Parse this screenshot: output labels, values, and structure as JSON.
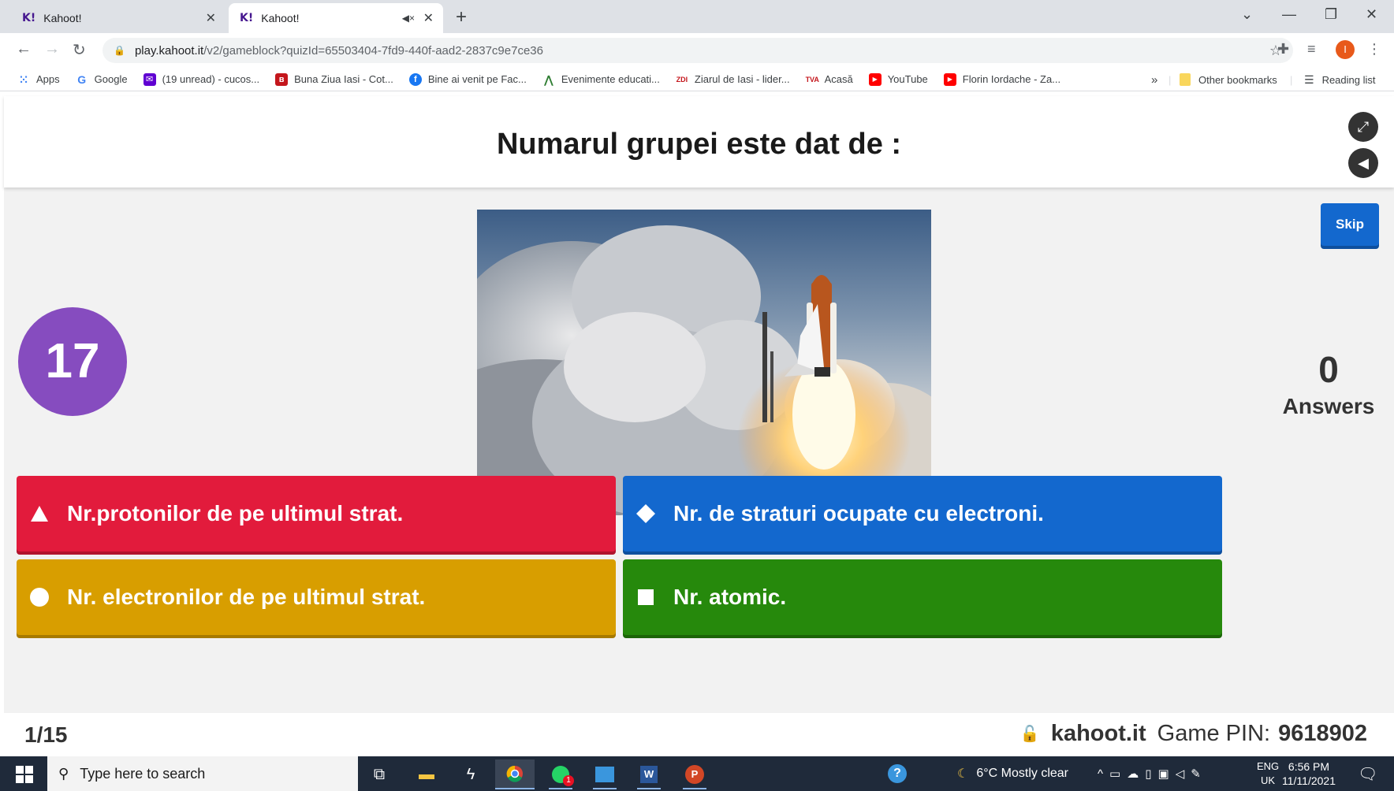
{
  "browser": {
    "tabs": [
      {
        "favicon": "K!",
        "title": "Kahoot!"
      },
      {
        "favicon": "K!",
        "title": "Kahoot!"
      }
    ],
    "url_host": "play.kahoot.it",
    "url_path": "/v2/gameblock?quizId=65503404-7fd9-440f-aad2-2837c9e7ce36",
    "bookmarks": [
      {
        "label": "Apps",
        "icon": "apps-grid-icon",
        "color": "#4285f4"
      },
      {
        "label": "Google",
        "icon": "google-icon",
        "color": "#4285f4"
      },
      {
        "label": "(19 unread) - cucos...",
        "icon": "yahoo-mail-icon",
        "color": "#6001d2"
      },
      {
        "label": "Buna Ziua Iasi - Cot...",
        "icon": "bzi-icon",
        "color": "#c4161c"
      },
      {
        "label": "Bine ai venit pe Fac...",
        "icon": "facebook-icon",
        "color": "#1877f2"
      },
      {
        "label": "Evenimente educati...",
        "icon": "events-icon",
        "color": "#2e7d32"
      },
      {
        "label": "Ziarul de Iasi - lider...",
        "icon": "zdi-icon",
        "color": "#c4161c"
      },
      {
        "label": "Acasă",
        "icon": "tva-icon",
        "color": "#c4161c"
      },
      {
        "label": "YouTube",
        "icon": "youtube-icon",
        "color": "#ff0000"
      },
      {
        "label": "Florin Iordache - Za...",
        "icon": "youtube-icon",
        "color": "#ff0000"
      }
    ],
    "bookmarks_overflow": "»",
    "other_bookmarks": "Other bookmarks",
    "reading_list": "Reading list",
    "profile_initial": "I"
  },
  "game": {
    "question": "Numarul grupei este dat de :",
    "skip_label": "Skip",
    "timer": "17",
    "answers_count": "0",
    "answers_label": "Answers",
    "options": [
      {
        "shape": "triangle",
        "text": "Nr.protonilor de pe ultimul strat.",
        "color": "#e21b3c"
      },
      {
        "shape": "diamond",
        "text": "Nr. de straturi ocupate cu electroni.",
        "color": "#1368ce"
      },
      {
        "shape": "circle",
        "text": "Nr. electronilor de pe ultimul strat.",
        "color": "#d89e00"
      },
      {
        "shape": "square",
        "text": "Nr. atomic.",
        "color": "#26890c"
      }
    ],
    "progress": "1/15",
    "site": "kahoot.it",
    "pin_label": "Game PIN:",
    "pin": "9618902"
  },
  "taskbar": {
    "search_placeholder": "Type here to search",
    "weather": "6°C  Mostly clear",
    "lang_top": "ENG",
    "lang_bottom": "UK",
    "time": "6:56 PM",
    "date": "11/11/2021",
    "whatsapp_badge": "1"
  }
}
